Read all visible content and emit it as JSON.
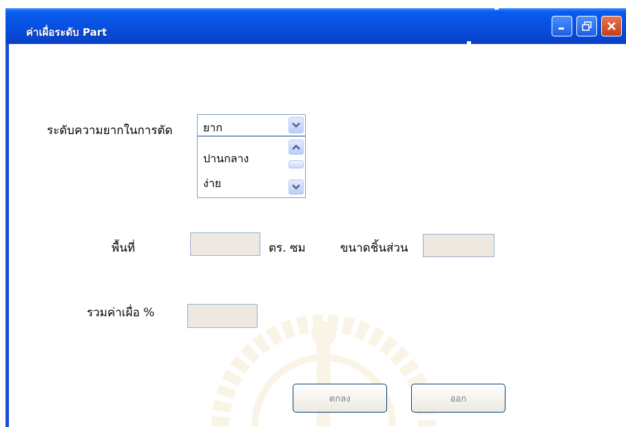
{
  "window": {
    "title": "ค่าเผื่อระดับ Part"
  },
  "form": {
    "difficulty_label": "ระดับความยากในการตัด",
    "difficulty_selected": "ยาก",
    "difficulty_options": [
      "ปานกลาง",
      "ง่าย"
    ],
    "area_label": "พื้นที่",
    "area_value": "",
    "area_unit": "ตร. ซม",
    "part_size_label": "ขนาดชิ้นส่วน",
    "part_size_value": "",
    "total_allowance_label": "รวมค่าเผื่อ %",
    "total_allowance_value": ""
  },
  "buttons": {
    "ok_label": "ตกลง",
    "exit_label": "ออก"
  },
  "colors": {
    "titlebar": "#0a5cf0",
    "field_bg": "#ede9e0",
    "close_button": "#c2401c"
  }
}
